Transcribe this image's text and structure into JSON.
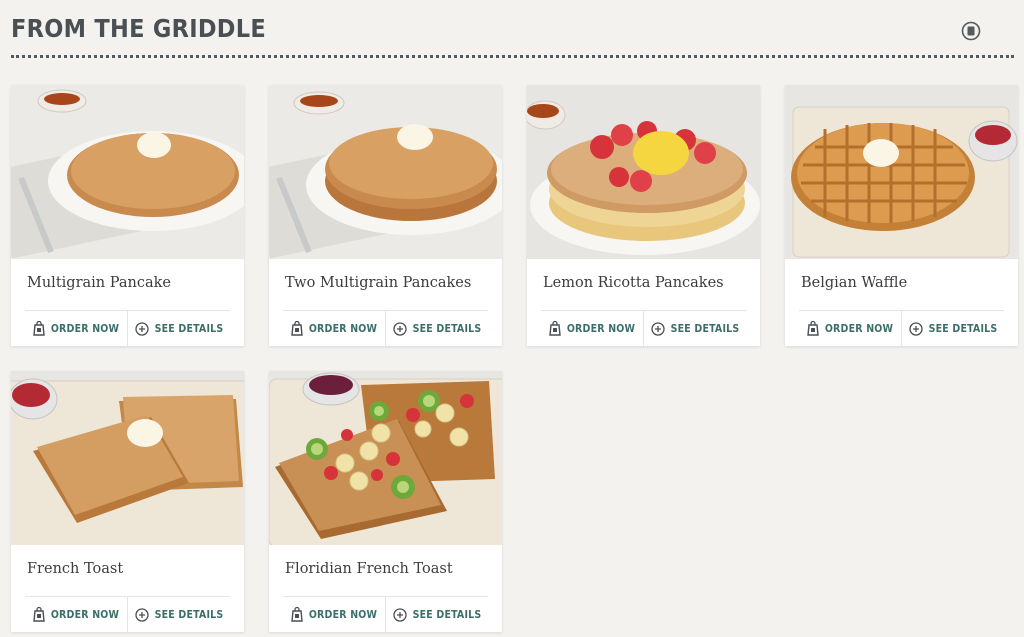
{
  "section": {
    "title": "FROM THE GRIDDLE",
    "view_single_icon": "single-view-icon",
    "view_grid_icon": "grid-view-icon"
  },
  "colors": {
    "accent": "#3b6e68",
    "title": "#4a4f53",
    "background": "#f3f2ef"
  },
  "actions": {
    "order_label": "ORDER NOW",
    "details_label": "SEE DETAILS",
    "order_icon": "order-bag-icon",
    "details_icon": "plus-circle-icon"
  },
  "items": [
    {
      "name": "Multigrain Pancake",
      "image": "single multigrain pancake with butter and syrup"
    },
    {
      "name": "Two Multigrain Pancakes",
      "image": "two multigrain pancakes with butter and syrup"
    },
    {
      "name": "Lemon Ricotta Pancakes",
      "image": "lemon ricotta pancakes with strawberries"
    },
    {
      "name": "Belgian Waffle",
      "image": "belgian waffle with butter and strawberry cup"
    },
    {
      "name": "French Toast",
      "image": "french toast with butter and jam"
    },
    {
      "name": "Floridian French Toast",
      "image": "french toast topped with kiwi, banana and strawberries"
    }
  ]
}
